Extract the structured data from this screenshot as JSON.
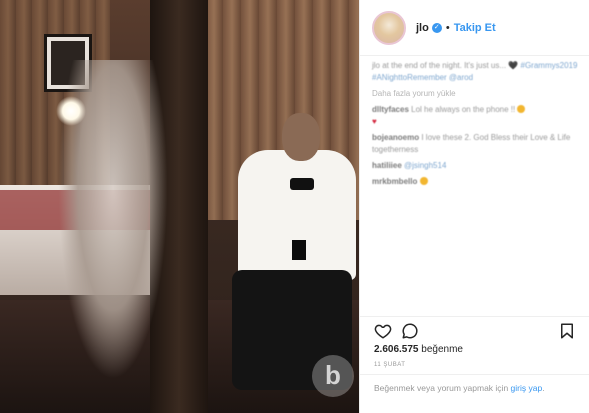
{
  "post": {
    "username": "jlo",
    "follow_label": "Takip Et",
    "dot": "•",
    "caption": {
      "text": "jlo at the end of the night. It's just us...",
      "emoji": "🖤",
      "hashtags": "#Grammys2019 #ANighttoRemember @arod"
    },
    "load_more": "Daha fazla yorum yükle",
    "comments": [
      {
        "user": "dlltyfaces",
        "text": "Lol he always on the phone !!",
        "emoji": "face"
      },
      {
        "user": "",
        "text": "",
        "emoji": "heart"
      },
      {
        "user": "bojeanoemo",
        "text": "I love these 2. God Bless their Love & Life togetherness",
        "emoji": ""
      },
      {
        "user": "hatiliiee",
        "text": "@jsingh514",
        "emoji": ""
      },
      {
        "user": "mrkbmbello",
        "text": "",
        "emoji": "face"
      }
    ],
    "likes_count": "2.606.575",
    "likes_label": "beğenme",
    "date": "11 ŞUBAT",
    "footer": {
      "text": "Beğenmek veya yorum yapmak için ",
      "link": "giriş yap",
      "suffix": "."
    }
  },
  "watermark": "b",
  "icons": {
    "like": "heart-outline-icon",
    "comment": "speech-bubble-icon",
    "save": "bookmark-icon",
    "verified": "verified-badge-icon"
  },
  "colors": {
    "link": "#3897f0",
    "text": "#262626",
    "muted": "#999999"
  }
}
